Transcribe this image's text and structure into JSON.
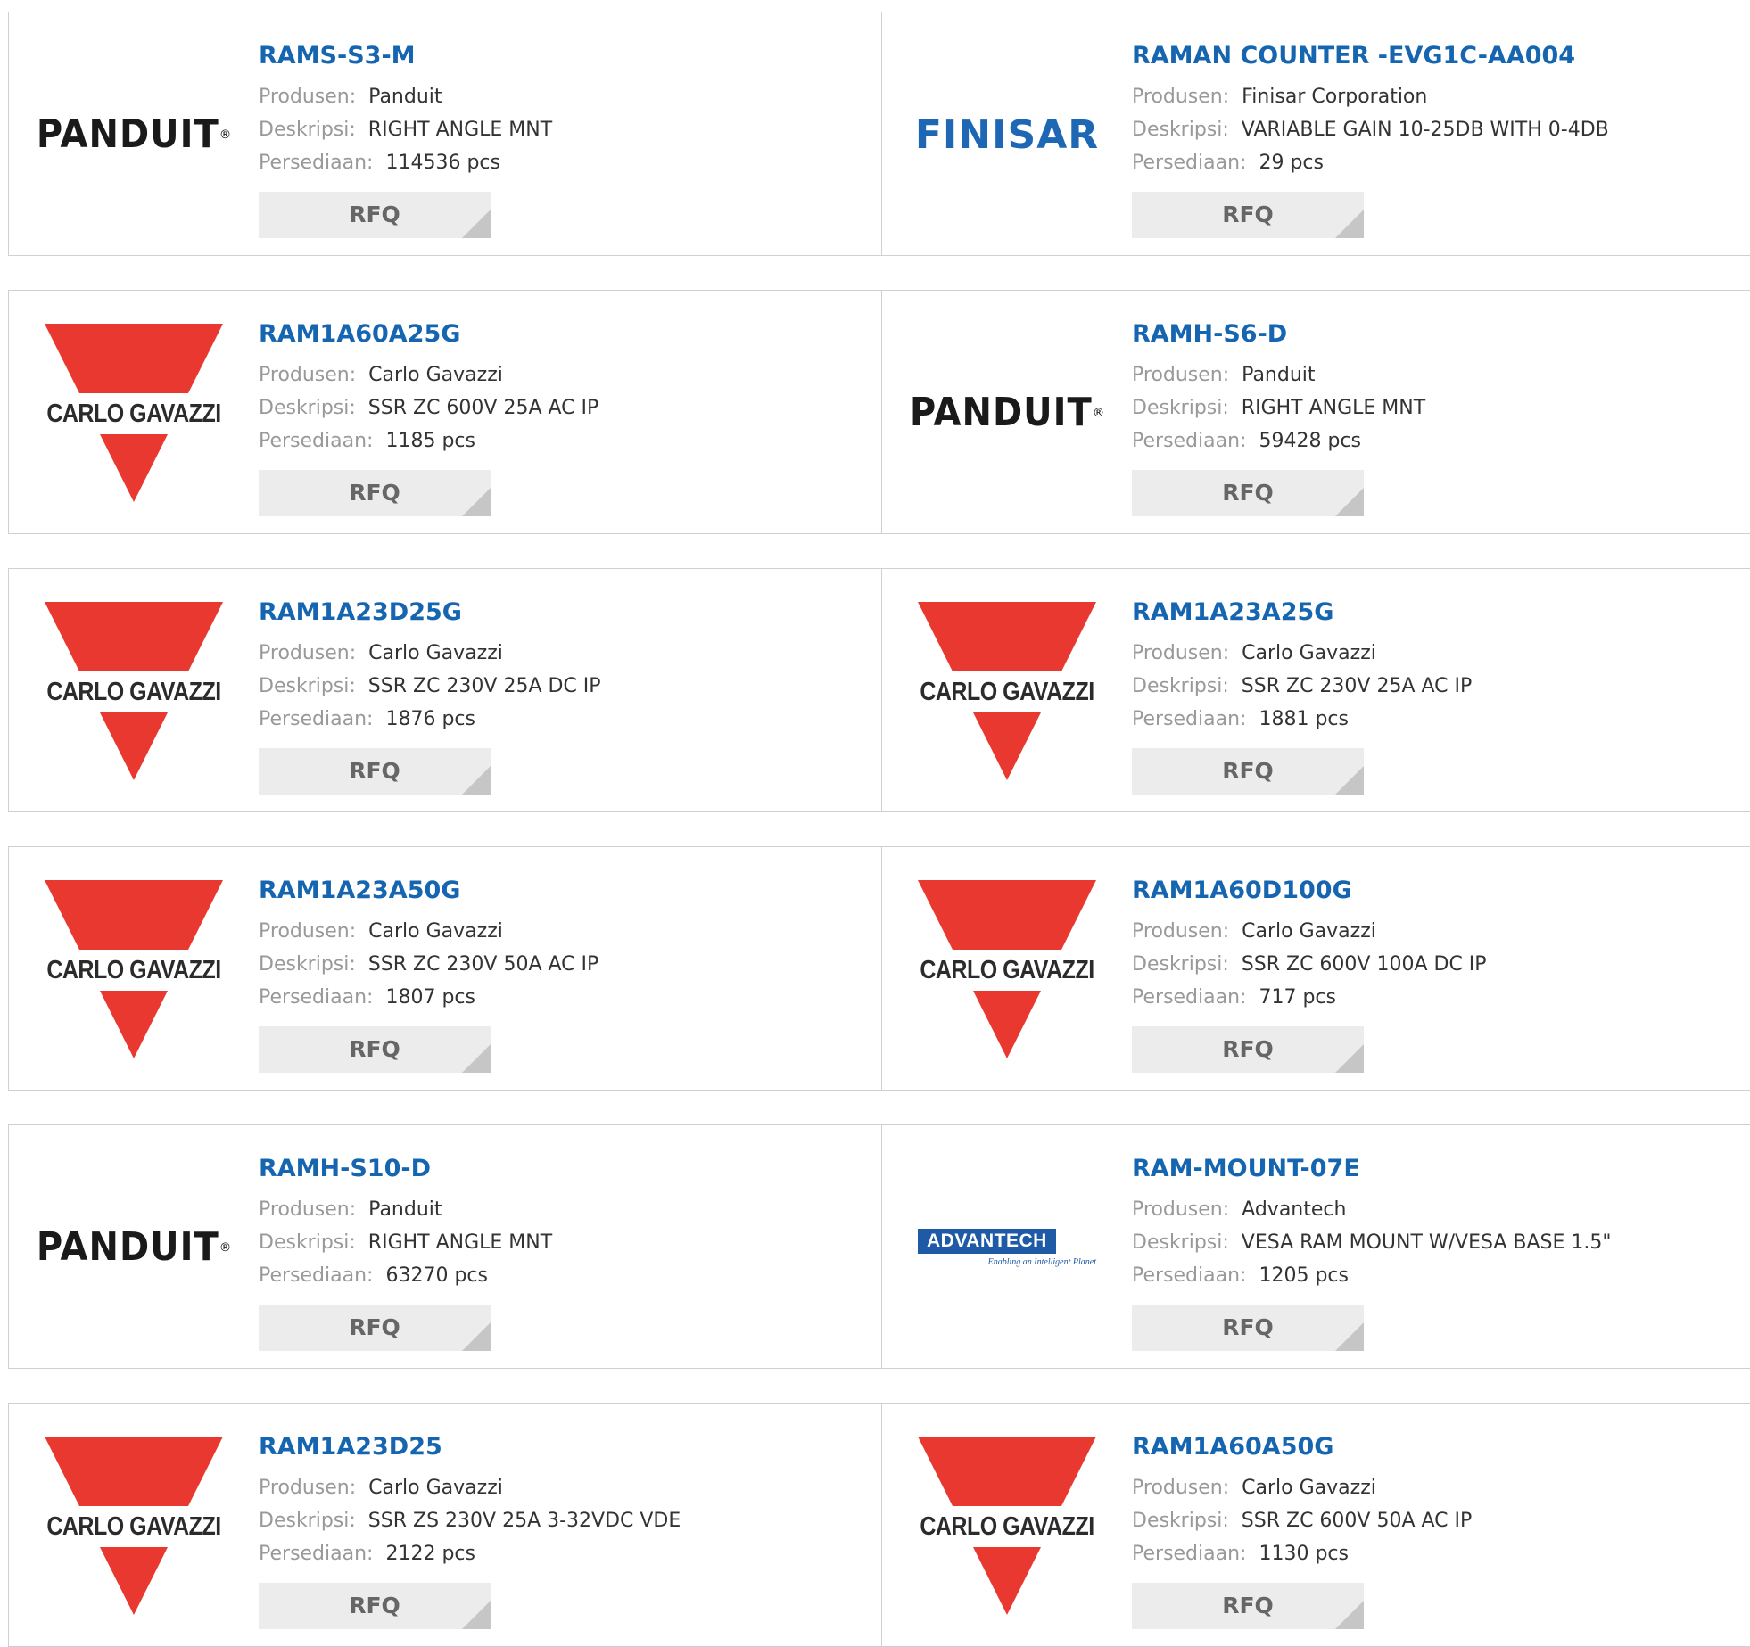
{
  "labels": {
    "manufacturer": "Produsen:",
    "description": "Deskripsi:",
    "stock": "Persediaan:",
    "rfq": "RFQ"
  },
  "brands": {
    "panduit": {
      "text": "PANDUIT",
      "registered": "®"
    },
    "finisar": {
      "text": "FINISAR",
      "color": "#1e67b4"
    },
    "carlo_gavazzi": {
      "text": "CARLO GAVAZZI",
      "color": "#e8382f"
    },
    "advantech": {
      "text": "ADVANTECH",
      "tagline": "Enabling an Intelligent Planet",
      "color": "#1f5aa6"
    }
  },
  "colors": {
    "link": "#1565b0",
    "label": "#999999",
    "value": "#333333",
    "button_bg": "#ececec"
  },
  "products": [
    {
      "part": "RAMS-S3-M",
      "brand": "panduit",
      "manufacturer": "Panduit",
      "description": "RIGHT ANGLE MNT",
      "stock": "114536 pcs"
    },
    {
      "part": "RAMAN COUNTER -EVG1C-AA004",
      "brand": "finisar",
      "manufacturer": "Finisar Corporation",
      "description": "VARIABLE GAIN 10-25DB WITH 0-4DB",
      "stock": "29 pcs"
    },
    {
      "part": "RAM1A60A25G",
      "brand": "carlo_gavazzi",
      "manufacturer": "Carlo Gavazzi",
      "description": "SSR ZC 600V 25A AC IP",
      "stock": "1185 pcs"
    },
    {
      "part": "RAMH-S6-D",
      "brand": "panduit",
      "manufacturer": "Panduit",
      "description": "RIGHT ANGLE MNT",
      "stock": "59428 pcs"
    },
    {
      "part": "RAM1A23D25G",
      "brand": "carlo_gavazzi",
      "manufacturer": "Carlo Gavazzi",
      "description": "SSR ZC 230V 25A DC IP",
      "stock": "1876 pcs"
    },
    {
      "part": "RAM1A23A25G",
      "brand": "carlo_gavazzi",
      "manufacturer": "Carlo Gavazzi",
      "description": "SSR ZC 230V 25A AC IP",
      "stock": "1881 pcs"
    },
    {
      "part": "RAM1A23A50G",
      "brand": "carlo_gavazzi",
      "manufacturer": "Carlo Gavazzi",
      "description": "SSR ZC 230V 50A AC IP",
      "stock": "1807 pcs"
    },
    {
      "part": "RAM1A60D100G",
      "brand": "carlo_gavazzi",
      "manufacturer": "Carlo Gavazzi",
      "description": "SSR ZC 600V 100A DC IP",
      "stock": "717 pcs"
    },
    {
      "part": "RAMH-S10-D",
      "brand": "panduit",
      "manufacturer": "Panduit",
      "description": "RIGHT ANGLE MNT",
      "stock": "63270 pcs"
    },
    {
      "part": "RAM-MOUNT-07E",
      "brand": "advantech",
      "manufacturer": "Advantech",
      "description": "VESA RAM MOUNT W/VESA BASE 1.5\"",
      "stock": "1205 pcs"
    },
    {
      "part": "RAM1A23D25",
      "brand": "carlo_gavazzi",
      "manufacturer": "Carlo Gavazzi",
      "description": "SSR ZS 230V 25A 3-32VDC VDE",
      "stock": "2122 pcs"
    },
    {
      "part": "RAM1A60A50G",
      "brand": "carlo_gavazzi",
      "manufacturer": "Carlo Gavazzi",
      "description": "SSR ZC 600V 50A AC IP",
      "stock": "1130 pcs"
    }
  ]
}
